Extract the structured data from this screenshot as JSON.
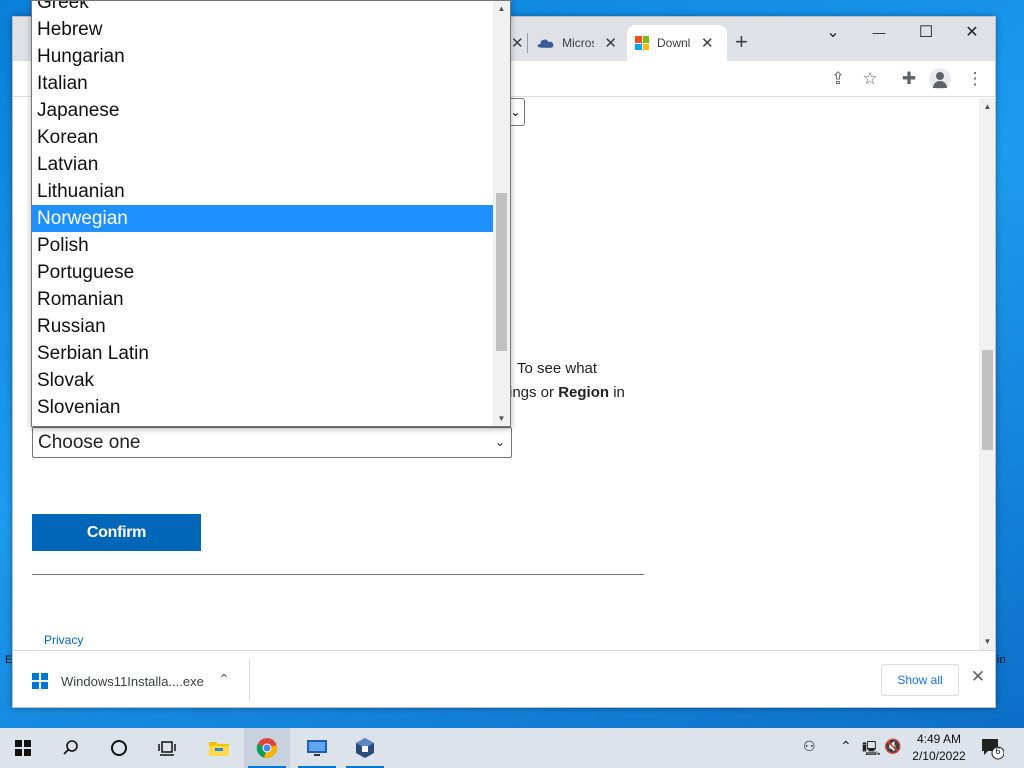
{
  "desktop": {
    "left_edge_text": "E",
    "right_edge_text": "in"
  },
  "browser": {
    "tabs": [
      {
        "title": "Micros",
        "icon": "onedrive-icon"
      },
      {
        "title": "Downl",
        "icon": "microsoft-logo-icon",
        "active": true
      }
    ],
    "new_tab_label": "+",
    "window_controls": {
      "tab_search": "⌄",
      "minimize": "—",
      "maximize": "☐",
      "close": "✕"
    },
    "toolbar_icons": [
      "share-icon",
      "star-icon",
      "extensions-icon",
      "profile-icon",
      "menu-icon"
    ]
  },
  "page": {
    "text_line_1_prefix": "To see what",
    "text_line_2_prefix": "ings or ",
    "text_line_2_bold": "Region",
    "text_line_2_suffix": " in",
    "language_select": {
      "value": "Choose one"
    },
    "confirm_label": "Confirm",
    "privacy_label": "Privacy"
  },
  "dropdown": {
    "options": [
      "Greek",
      "Hebrew",
      "Hungarian",
      "Italian",
      "Japanese",
      "Korean",
      "Latvian",
      "Lithuanian",
      "Norwegian",
      "Polish",
      "Portuguese",
      "Romanian",
      "Russian",
      "Serbian Latin",
      "Slovak",
      "Slovenian"
    ],
    "highlighted": "Norwegian"
  },
  "download_bar": {
    "file_name": "Windows11Installa....exe",
    "show_all_label": "Show all"
  },
  "taskbar": {
    "apps": [
      "start-icon",
      "search-icon",
      "cortana-icon",
      "task-view-icon",
      "file-explorer-icon",
      "chrome-icon",
      "remote-desktop-icon",
      "virtualbox-icon"
    ],
    "clock_time": "4:49 AM",
    "clock_date": "2/10/2022",
    "notification_count": "6"
  },
  "colors": {
    "accent": "#0067b8",
    "selection": "#1e90ff",
    "chrome_tabstrip": "#dee1e6"
  }
}
